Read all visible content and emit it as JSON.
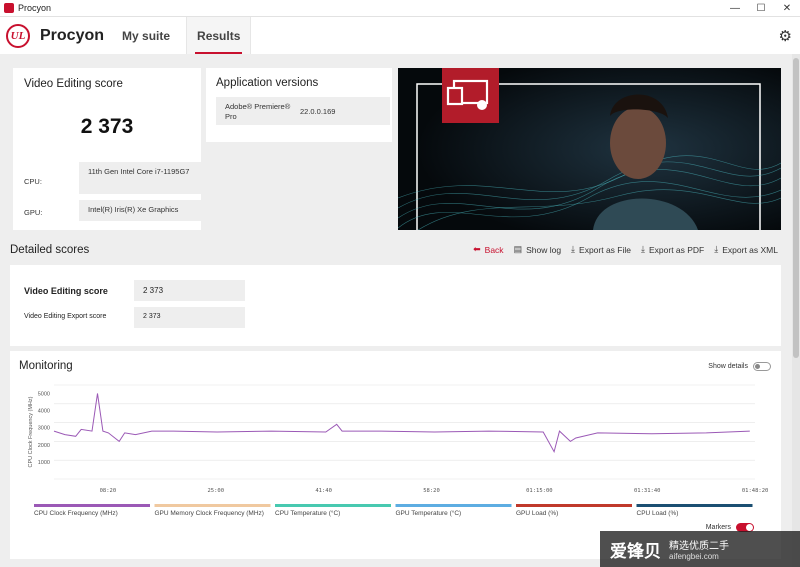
{
  "window": {
    "title": "Procyon",
    "minimize": "—",
    "maximize": "☐",
    "close": "✕"
  },
  "header": {
    "logo_text": "UL",
    "app_name": "Procyon",
    "tabs": [
      {
        "label": "My suite"
      },
      {
        "label": "Results"
      }
    ],
    "active_tab": "Results",
    "settings_icon": "⚙"
  },
  "score_card": {
    "title": "Video Editing score",
    "score": "2 373",
    "cpu_label": "CPU:",
    "cpu_value": "11th Gen Intel Core i7-1195G7",
    "gpu_label": "GPU:",
    "gpu_value": "Intel(R) Iris(R) Xe Graphics"
  },
  "app_versions": {
    "title": "Application versions",
    "app_name": "Adobe® Premiere® Pro",
    "app_version": "22.0.0.169"
  },
  "detailed": {
    "title": "Detailed scores",
    "actions": [
      {
        "label": "Back",
        "icon": "⬅"
      },
      {
        "label": "Show log",
        "icon": "▤"
      },
      {
        "label": "Export as File",
        "icon": "⤓"
      },
      {
        "label": "Export as PDF",
        "icon": "⤓"
      },
      {
        "label": "Export as XML",
        "icon": "⤓"
      }
    ],
    "rows": [
      {
        "label": "Video Editing score",
        "value": "2 373"
      },
      {
        "label": "Video Editing Export score",
        "value": "2 373"
      }
    ]
  },
  "monitoring": {
    "title": "Monitoring",
    "show_details": "Show details",
    "markers": "Markers",
    "legend": [
      {
        "label": "CPU Clock Frequency (MHz)",
        "color": "#9b59b6"
      },
      {
        "label": "GPU Memory Clock Frequency (MHz)",
        "color": "#f0c9a0"
      },
      {
        "label": "CPU Temperature (°C)",
        "color": "#48c9b0"
      },
      {
        "label": "GPU Temperature (°C)",
        "color": "#5dade2"
      },
      {
        "label": "GPU Load (%)",
        "color": "#c0392b"
      },
      {
        "label": "CPU Load (%)",
        "color": "#1b4f72"
      }
    ]
  },
  "chart_data": {
    "type": "line",
    "ylabel": "CPU Clock Frequency (MHz)",
    "yticks": [
      "1000",
      "2000",
      "3000",
      "4000",
      "5000"
    ],
    "xticks": [
      "08:20",
      "25:00",
      "41:40",
      "58:20",
      "01:15:00",
      "01:31:40",
      "01:48:20"
    ],
    "ylim": [
      0,
      5500
    ],
    "series": [
      {
        "name": "CPU Clock Frequency (MHz)",
        "color": "#9b59b6",
        "x_minutes": [
          0,
          2,
          4,
          5,
          7,
          8,
          9,
          10,
          12,
          13,
          15,
          18,
          22,
          30,
          40,
          50,
          52,
          53,
          60,
          70,
          80,
          90,
          92,
          93,
          95,
          96,
          100,
          110,
          120,
          128
        ],
        "y": [
          2800,
          2600,
          2500,
          2900,
          2800,
          5000,
          2800,
          2700,
          2200,
          2700,
          2600,
          2800,
          2800,
          2750,
          2800,
          2750,
          3200,
          2800,
          2800,
          2750,
          2800,
          2750,
          1600,
          2800,
          2200,
          2400,
          2700,
          2650,
          2700,
          2800
        ]
      }
    ],
    "grid": true
  },
  "watermark": {
    "main": "爱锋贝",
    "line1": "精选优质二手",
    "line2": "aifengbei.com"
  }
}
